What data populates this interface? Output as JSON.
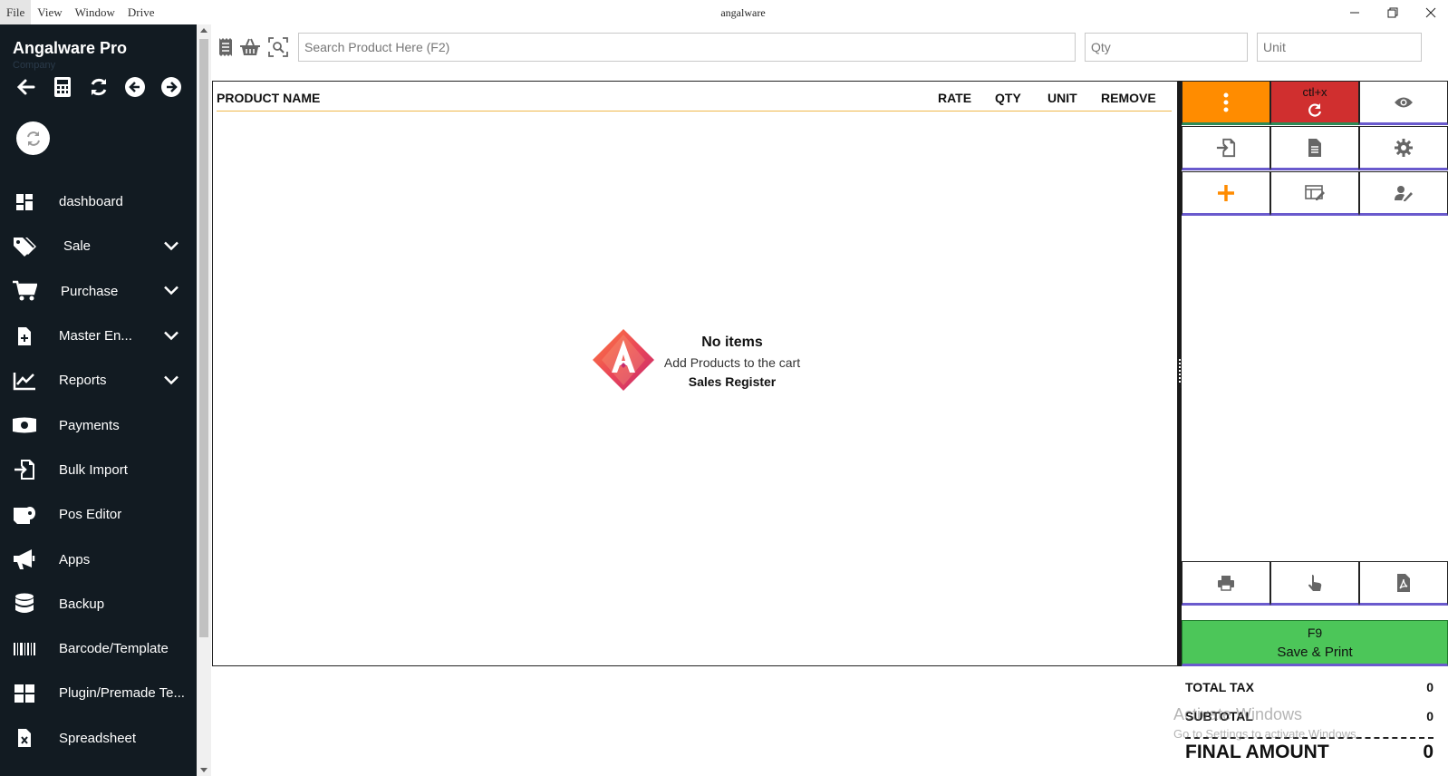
{
  "window": {
    "title": "angalware",
    "menu": [
      "File",
      "View",
      "Window",
      "Drive"
    ]
  },
  "sidebar": {
    "brand": "Angalware Pro",
    "company": "Company",
    "items": [
      {
        "label": "dashboard",
        "icon": "dashboard-icon",
        "expandable": false
      },
      {
        "label": "Sale",
        "icon": "tags-icon",
        "expandable": true
      },
      {
        "label": "Purchase",
        "icon": "cart-icon",
        "expandable": true
      },
      {
        "label": "Master En...",
        "icon": "file-plus-icon",
        "expandable": true
      },
      {
        "label": "Reports",
        "icon": "chart-line-icon",
        "expandable": true
      },
      {
        "label": "Payments",
        "icon": "money-icon",
        "expandable": false
      },
      {
        "label": "Bulk Import",
        "icon": "import-icon",
        "expandable": false
      },
      {
        "label": "Pos Editor",
        "icon": "receipt-roll-icon",
        "expandable": false
      },
      {
        "label": "Apps",
        "icon": "megaphone-icon",
        "expandable": false
      },
      {
        "label": "Backup",
        "icon": "database-icon",
        "expandable": false
      },
      {
        "label": "Barcode/Template",
        "icon": "barcode-icon",
        "expandable": false
      },
      {
        "label": "Plugin/Premade Te...",
        "icon": "grid-icon",
        "expandable": false
      },
      {
        "label": "Spreadsheet",
        "icon": "spreadsheet-icon",
        "expandable": false
      }
    ]
  },
  "search": {
    "product_placeholder": "Search Product Here (F2)",
    "qty_placeholder": "Qty",
    "unit_placeholder": "Unit"
  },
  "cart": {
    "columns": {
      "product_name": "PRODUCT NAME",
      "rate": "RATE",
      "qty": "QTY",
      "unit": "UNIT",
      "remove": "REMOVE"
    },
    "empty": {
      "title": "No items",
      "subtitle": "Add Products to the cart",
      "register": "Sales Register"
    }
  },
  "panel": {
    "reset_shortcut": "ctl+x",
    "save": {
      "shortcut": "F9",
      "label": "Save & Print"
    }
  },
  "totals": {
    "total_tax_label": "TOTAL TAX",
    "total_tax": "0",
    "subtotal_label": "SUBTOTAL",
    "subtotal": "0",
    "final_label": "FINAL AMOUNT",
    "final": "0"
  },
  "watermark": {
    "line1": "Activate Windows",
    "line2": "Go to Settings to activate Windows."
  },
  "colors": {
    "sidebar_bg": "#121b22",
    "orange": "#ff8c00",
    "red": "#d02f2f",
    "green": "#4cc659",
    "accent_purple": "#6a5acd"
  }
}
